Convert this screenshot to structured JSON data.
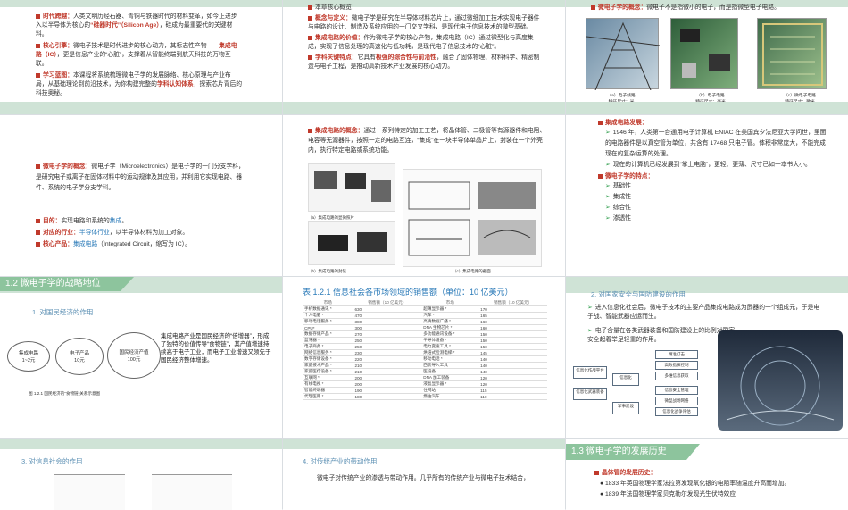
{
  "s1": {
    "items": [
      {
        "label": "时代跨越：",
        "text": "人类文明历经石器、青铜与铁器时代的材料变革，如今正进步入以半导体为核心的",
        "hl": "“硅器时代”（Silicon Age）",
        "tail": "，硅成为最重要代的关键材料。"
      },
      {
        "label": "核心引擎：",
        "text": "微电子技术是时代进步的核心动力，其标志性产物——",
        "hl": "集成电路（IC）",
        "tail": "，更是信息产业的“心脏”，支撑着从智能终端到航天科技的万物互联。"
      },
      {
        "label": "学习蓝图：",
        "text": "本课程将系统梳理微电子学的发展脉络、核心原理与产业布局，从基础理论到前沿技术，为你构建完整的",
        "hl": "学科认知体系",
        "tail": "，探索芯片背后的科技奥秘。"
      }
    ]
  },
  "s2": {
    "intro": "本章核心概览：",
    "items": [
      {
        "label": "概念与定义：",
        "text": "微电子学是研究在半导体材料芯片上，通过微细加工技术实现电子器件与电路的设计、制造及系统应用的一门交叉学科，是现代电子信息技术的微型基础。"
      },
      {
        "label": "集成电路的价值：",
        "text": "作为微电子学的核心产物，集成电路（IC）通过微型化与高度集成，实现了信息处理的高速化与低功耗，是现代电子信息技术的“心脏”。"
      },
      {
        "label": "学科关键特点：",
        "text": "它具有",
        "hl": "极强的综合性与前沿性",
        "tail": "，融合了固体物理、材料科学、精密制造与电子工程，是推动高新技术产业发展的核心动力。"
      }
    ]
  },
  "s3": {
    "label": "微电子学的概念：",
    "text": "微电子不是指微小的电子，而是指微型电子电路。",
    "captions": [
      {
        "name": "（a）电子线路",
        "size": "特征尺寸：米"
      },
      {
        "name": "（b）电子电路",
        "size": "特征尺寸：毫米"
      },
      {
        "name": "（c）微电子电路",
        "size": "特征尺寸：微米"
      }
    ]
  },
  "s4": {
    "lines": [
      {
        "label": "微电子学的概念：",
        "text": "微电子学（Microelectronics）是电子学的一门分支学科，是研究电子或离子在固体材料中的运动规律及其应用，并利用它实现电路、器件、系统的电子学分支学科。",
        "parts": [
          "设计",
          "制造",
          "测试",
          "封装"
        ]
      },
      {
        "label": "目的：",
        "text": "实现电路和系统的",
        "hl": "集成",
        "tail": "。"
      },
      {
        "label": "对应的行业：",
        "text": "半导体行业",
        "tail": "，以半导体材料为加工对象。"
      },
      {
        "label": "核心产品：",
        "text": "集成电路",
        "tail": "（Integrated Circuit，缩写为 IC）。"
      }
    ]
  },
  "s5": {
    "label": "集成电路的概念：",
    "text": "通过一系列特定的加工工艺，将晶体管、二极管等有源器件和电阻、电容等无源器件，按照一定的电路互连，“集成”在一块半导体单晶片上，封装在一个外壳内，执行特定电路或系统功能。",
    "captions": [
      "（a）集成电路的显微照片",
      "（b）集成电路的封装",
      "（c）集成电路的截面"
    ]
  },
  "s6": {
    "title": "集成电路发展：",
    "b1": "1946 年，人类第一台通用电子计算机 ENIAC 在美国宾夕法尼亚大学问世，里面的电路器件是以真空管为单位，共含有 17468 只电子管。体积非常庞大，不能完成现在的复杂运算的处理。",
    "b2": "现在的计算机已经发展到“掌上电脑”，更轻、更薄、尺寸已如一本书大小。",
    "features_title": "微电子学的特点：",
    "features": [
      "基础性",
      "集成性",
      "综合性",
      "渗透性"
    ]
  },
  "s7": {
    "band": "1.2  微电子学的战略地位",
    "section": "1. 对国民经济的作用",
    "e1": "集成电路\n1~2元",
    "e2": "电子产品\n10元",
    "e3": "国民经济产值\n100元",
    "caption": "图 1.2.1  国民经济的“食物链”关系示意图",
    "text": "集成电路产业是国民经济的“倍增器”，形成了独特的价值传导“食物链”，其产值增速持续高于电子工业，而电子工业增速又领先于国民经济整体增速。"
  },
  "s8": {
    "title": "表 1.2.1  信息社会各市场领域的销售额（单位：10 亿美元）",
    "headers": [
      "市场",
      "销售额（10 亿美元）",
      "市场",
      "销售额（10 亿美元）"
    ],
    "rows": [
      [
        "手机数据通讯 *",
        "630",
        "超薄显示器 *",
        "170"
      ],
      [
        "个人电脑 *",
        "470",
        "汽车 *",
        "165"
      ],
      [
        "移动电话服务 *",
        "380",
        "高清数据广播 *",
        "160"
      ],
      [
        "CPU*",
        "300",
        "DNA 生物芯片 *",
        "160"
      ],
      [
        "数据存储产品 *",
        "270",
        "多功能通讯设备 *",
        "150"
      ],
      [
        "蓝牙器 *",
        "250",
        "半导体设备 *",
        "150"
      ],
      [
        "电子商务 *",
        "250",
        "电力变速工具 *",
        "150"
      ],
      [
        "网络信息服务 *",
        "230",
        "烘焙式检测电梯 *",
        "145"
      ],
      [
        "数字存储设备 *",
        "220",
        "移动电话 *",
        "140"
      ],
      [
        "家庭技术产品 *",
        "210",
        "西装导入工具",
        "140"
      ],
      [
        "家庭医疗设备 *",
        "210",
        "医设备",
        "140"
      ],
      [
        "互联网 *",
        "200",
        "DNA 加工装备",
        "120"
      ],
      [
        "有线电视 *",
        "200",
        "液晶显示器 *",
        "120"
      ],
      [
        "智能终端器",
        "190",
        "住网站",
        "115"
      ],
      [
        "代理医用 *",
        "180",
        "燃油汽车",
        "110"
      ]
    ]
  },
  "s9": {
    "section": "2. 对国家安全与国防建设的作用",
    "b1": "进入信息化社会后，微电子技术的主要产品集成电路成为武器的一个组成元，于是电子战、智能武器应运而生。",
    "b2": "电子含量在各类武器装备和国防建设上的比例对国家安全起着举足轻重的作用。",
    "boxes": [
      "信息化作战平台",
      "信息化武器装备",
      "信息化",
      "军事建设",
      "精准打击",
      "高效指挥控制",
      "多维信息获取",
      "信息安全管理",
      "微型战场网络",
      "信息化战争评估"
    ]
  },
  "s10": {
    "section": "3. 对信息社会的作用"
  },
  "s11": {
    "section": "4. 对传统产业的带动作用",
    "text": "微电子对传统产业的渗透与带动作用。几乎所有的传统产业与微电子技术结合，"
  },
  "s12": {
    "band": "1.3  微电子学的发展历史",
    "label": "晶体管的发展历史：",
    "b1": "1833 年英国物理学家法拉第发现氧化银的电阻率随温度升高而增加。",
    "b2": "1839 年法国物理学家贝克勒尔发现光生伏特效应"
  }
}
